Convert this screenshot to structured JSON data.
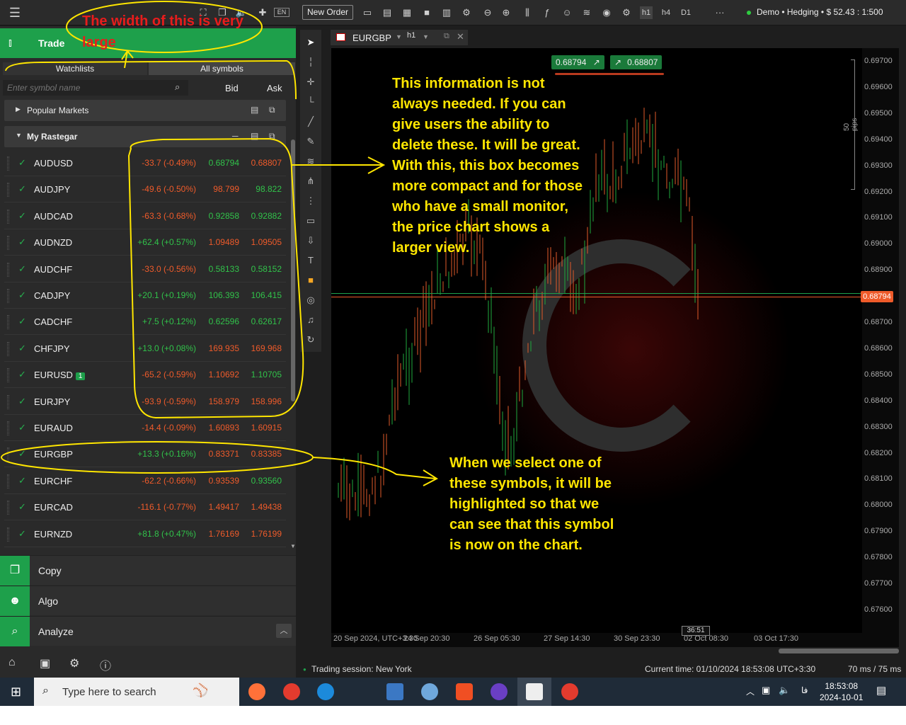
{
  "topbar": {
    "new_order": "New Order",
    "timeframes": [
      "h1",
      "h4",
      "D1"
    ],
    "more": "···",
    "account": "Demo • Hedging • $ 52.43 : 1:500",
    "lang": "EN"
  },
  "left": {
    "trade_label": "Trade",
    "tabs": [
      "Watchlists",
      "All symbols"
    ],
    "search_placeholder": "Enter symbol name",
    "col_bid": "Bid",
    "col_ask": "Ask",
    "popular": "Popular Markets",
    "mylist": "My Rastegar",
    "rows": [
      {
        "sym": "AUDUSD",
        "chg": "-33.7 (-0.49%)",
        "bid": "0.68794",
        "ask": "0.68807",
        "dir": "dn",
        "bid_dir": "up",
        "ask_dir": "dn"
      },
      {
        "sym": "AUDJPY",
        "chg": "-49.6 (-0.50%)",
        "bid": "98.799",
        "ask": "98.822",
        "dir": "dn",
        "bid_dir": "dn",
        "ask_dir": "up"
      },
      {
        "sym": "AUDCAD",
        "chg": "-63.3 (-0.68%)",
        "bid": "0.92858",
        "ask": "0.92882",
        "dir": "dn",
        "bid_dir": "up",
        "ask_dir": "up"
      },
      {
        "sym": "AUDNZD",
        "chg": "+62.4 (+0.57%)",
        "bid": "1.09489",
        "ask": "1.09505",
        "dir": "up",
        "bid_dir": "dn",
        "ask_dir": "dn"
      },
      {
        "sym": "AUDCHF",
        "chg": "-33.0 (-0.56%)",
        "bid": "0.58133",
        "ask": "0.58152",
        "dir": "dn",
        "bid_dir": "up",
        "ask_dir": "up"
      },
      {
        "sym": "CADJPY",
        "chg": "+20.1 (+0.19%)",
        "bid": "106.393",
        "ask": "106.415",
        "dir": "up",
        "bid_dir": "up",
        "ask_dir": "up"
      },
      {
        "sym": "CADCHF",
        "chg": "+7.5 (+0.12%)",
        "bid": "0.62596",
        "ask": "0.62617",
        "dir": "up",
        "bid_dir": "up",
        "ask_dir": "up"
      },
      {
        "sym": "CHFJPY",
        "chg": "+13.0 (+0.08%)",
        "bid": "169.935",
        "ask": "169.968",
        "dir": "up",
        "bid_dir": "dn",
        "ask_dir": "dn"
      },
      {
        "sym": "EURUSD",
        "badge": "1",
        "chg": "-65.2 (-0.59%)",
        "bid": "1.10692",
        "ask": "1.10705",
        "dir": "dn",
        "bid_dir": "dn",
        "ask_dir": "up"
      },
      {
        "sym": "EURJPY",
        "chg": "-93.9 (-0.59%)",
        "bid": "158.979",
        "ask": "158.996",
        "dir": "dn",
        "bid_dir": "dn",
        "ask_dir": "dn"
      },
      {
        "sym": "EURAUD",
        "chg": "-14.4 (-0.09%)",
        "bid": "1.60893",
        "ask": "1.60915",
        "dir": "dn",
        "bid_dir": "dn",
        "ask_dir": "dn"
      },
      {
        "sym": "EURGBP",
        "chg": "+13.3 (+0.16%)",
        "bid": "0.83371",
        "ask": "0.83385",
        "dir": "up",
        "bid_dir": "dn",
        "ask_dir": "dn"
      },
      {
        "sym": "EURCHF",
        "chg": "-62.2 (-0.66%)",
        "bid": "0.93539",
        "ask": "0.93560",
        "dir": "dn",
        "bid_dir": "dn",
        "ask_dir": "up"
      },
      {
        "sym": "EURCAD",
        "chg": "-116.1 (-0.77%)",
        "bid": "1.49417",
        "ask": "1.49438",
        "dir": "dn",
        "bid_dir": "dn",
        "ask_dir": "dn"
      },
      {
        "sym": "EURNZD",
        "chg": "+81.8 (+0.47%)",
        "bid": "1.76169",
        "ask": "1.76199",
        "dir": "up",
        "bid_dir": "dn",
        "ask_dir": "dn"
      }
    ],
    "menu": [
      "Copy",
      "Algo",
      "Analyze"
    ]
  },
  "chart": {
    "tab_symbol": "EURGBP",
    "tab_tf": "h1",
    "sell_price": "0.68794",
    "buy_price": "0.68807",
    "pips_label": "50 pips",
    "current_price": "0.68794",
    "timer": "36:51",
    "y_ticks": [
      "0.69700",
      "0.69600",
      "0.69500",
      "0.69400",
      "0.69300",
      "0.69200",
      "0.69100",
      "0.69000",
      "0.68900",
      "0.68800",
      "0.68700",
      "0.68600",
      "0.68500",
      "0.68400",
      "0.68300",
      "0.68200",
      "0.68100",
      "0.68000",
      "0.67900",
      "0.67800",
      "0.67700",
      "0.67600"
    ],
    "x_ticks": [
      "20 Sep 2024, UTC+3:30",
      "24 Sep 20:30",
      "26 Sep 05:30",
      "27 Sep 14:30",
      "30 Sep 23:30",
      "02 Oct 08:30",
      "03 Oct 17:30"
    ]
  },
  "status": {
    "session": "Trading session: New York",
    "time": "Current time:  01/10/2024 18:53:08   UTC+3:30",
    "latency": "70 ms / 75 ms"
  },
  "taskbar": {
    "search": "Type here to search",
    "lang": "فا",
    "time": "18:53:08",
    "date": "2024-10-01"
  },
  "annotations": {
    "width_note": "The width of this is very large",
    "info_note": "This information is not always needed. If you can give users the ability to delete these. It will be great. With this, this box becomes more compact and for those who have a small monitor, the price chart shows a larger view.",
    "select_note": "When we select one of these symbols, it will be highlighted so that we can see that this symbol is now on the chart."
  }
}
